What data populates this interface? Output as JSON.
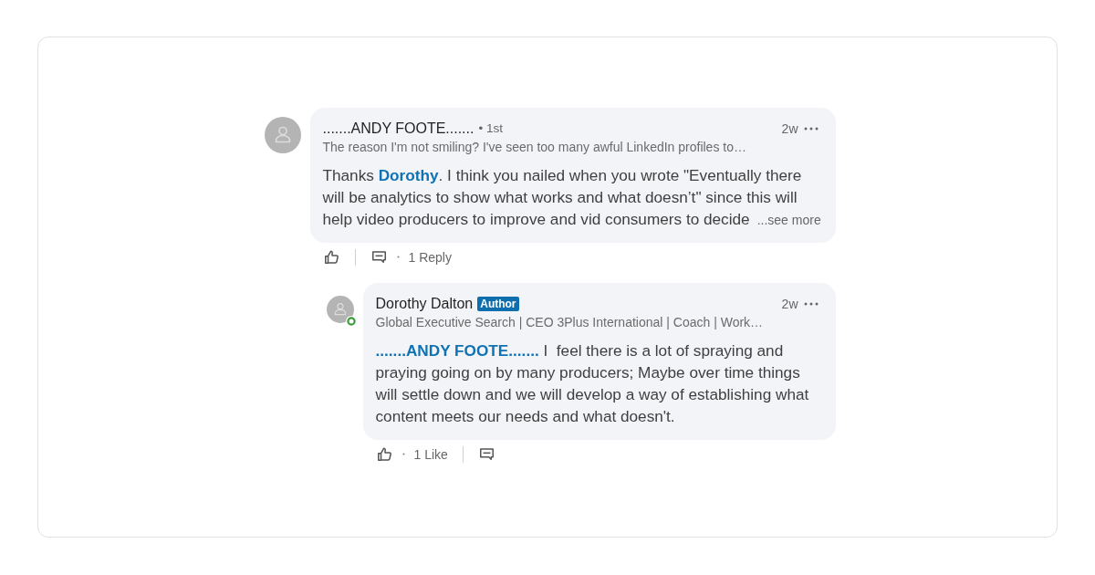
{
  "comments": [
    {
      "author": {
        "name": ".......ANDY FOOTE.......",
        "degree": "• 1st",
        "headline": "The reason I'm not smiling? I've seen too many awful LinkedIn profiles to…",
        "online": false
      },
      "time": "2w",
      "body": [
        {
          "kind": "text",
          "text": "Thanks "
        },
        {
          "kind": "mention",
          "text": "Dorothy"
        },
        {
          "kind": "text",
          "text": ". I think you nailed when you wrote \"Eventually there will be analytics to show what works and what doesn’t\" since this will help video producers to improve and vid consumers to decide"
        }
      ],
      "see_more": "...see more",
      "actions": [
        {
          "kind": "like"
        },
        {
          "kind": "reply",
          "count": "1 Reply"
        }
      ],
      "replies": [
        {
          "author": {
            "name": "Dorothy Dalton",
            "badge": "Author",
            "headline": "Global Executive Search | CEO 3Plus International | Coach | Work…",
            "online": true
          },
          "time": "2w",
          "body": [
            {
              "kind": "mention",
              "text": ".......ANDY FOOTE......."
            },
            {
              "kind": "text",
              "text": " I  feel there is a lot of spraying and praying going on by many producers; Maybe over time things will settle down and we will develop a way of establishing what content meets our needs and what doesn't."
            }
          ],
          "actions": [
            {
              "kind": "like",
              "count": "1 Like"
            },
            {
              "kind": "reply"
            }
          ]
        }
      ]
    }
  ]
}
